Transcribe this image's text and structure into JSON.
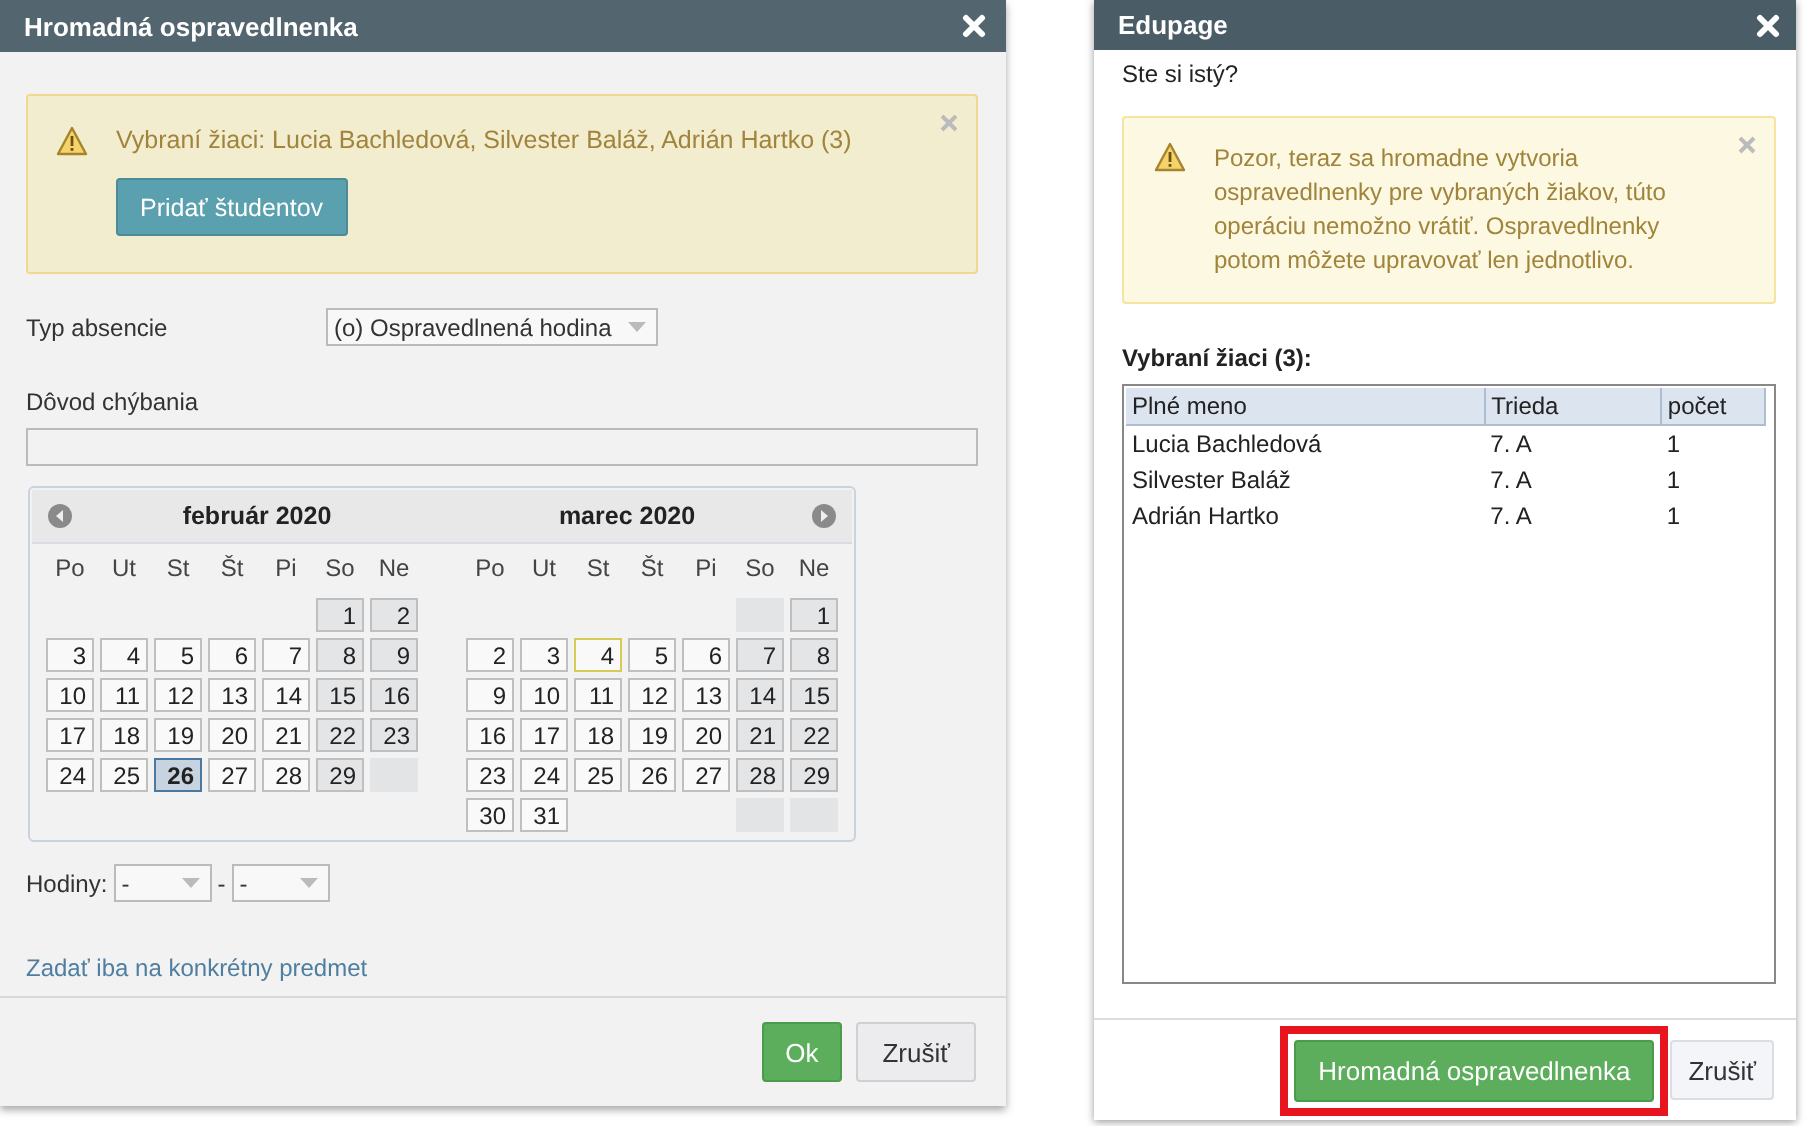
{
  "left_dialog": {
    "title": "Hromadná ospravedlnenka",
    "alert": {
      "text": "Vybraní žiaci: Lucia Bachledová, Silvester Baláž, Adrián Hartko (3)",
      "button": "Pridať študentov"
    },
    "absence_type": {
      "label": "Typ absencie",
      "value": "(o) Ospravedlnená hodina"
    },
    "reason": {
      "label": "Dôvod chýbania"
    },
    "calendar": {
      "months": [
        {
          "title": "február 2020",
          "weekdays": [
            "Po",
            "Ut",
            "St",
            "Št",
            "Pi",
            "So",
            "Ne"
          ],
          "weeks": [
            [
              {
                "day": "1",
                "selected": false,
                "today": false
              },
              {
                "day": "2",
                "selected": false,
                "today": false
              }
            ],
            [
              {
                "day": "3",
                "selected": false,
                "today": false
              },
              {
                "day": "4",
                "selected": false,
                "today": false
              },
              {
                "day": "5",
                "selected": false,
                "today": false
              },
              {
                "day": "6",
                "selected": false,
                "today": false
              },
              {
                "day": "7",
                "selected": false,
                "today": false
              },
              {
                "day": "8",
                "selected": false,
                "today": false
              },
              {
                "day": "9",
                "selected": false,
                "today": false
              }
            ],
            [
              {
                "day": "10",
                "selected": false,
                "today": false
              },
              {
                "day": "11",
                "selected": false,
                "today": false
              },
              {
                "day": "12",
                "selected": false,
                "today": false
              },
              {
                "day": "13",
                "selected": false,
                "today": false
              },
              {
                "day": "14",
                "selected": false,
                "today": false
              },
              {
                "day": "15",
                "selected": false,
                "today": false
              },
              {
                "day": "16",
                "selected": false,
                "today": false
              }
            ],
            [
              {
                "day": "17",
                "selected": false,
                "today": false
              },
              {
                "day": "18",
                "selected": false,
                "today": false
              },
              {
                "day": "19",
                "selected": false,
                "today": false
              },
              {
                "day": "20",
                "selected": false,
                "today": false
              },
              {
                "day": "21",
                "selected": false,
                "today": false
              },
              {
                "day": "22",
                "selected": false,
                "today": false
              },
              {
                "day": "23",
                "selected": false,
                "today": false
              }
            ],
            [
              {
                "day": "24",
                "selected": false,
                "today": false
              },
              {
                "day": "25",
                "selected": false,
                "today": false
              },
              {
                "day": "26",
                "selected": true,
                "today": false
              },
              {
                "day": "27",
                "selected": false,
                "today": false
              },
              {
                "day": "28",
                "selected": false,
                "today": false
              },
              {
                "day": "29",
                "selected": false,
                "today": false
              }
            ]
          ]
        },
        {
          "title": "marec 2020",
          "weekdays": [
            "Po",
            "Ut",
            "St",
            "Št",
            "Pi",
            "So",
            "Ne"
          ],
          "weeks": [
            [
              {
                "day": "1",
                "selected": false,
                "today": false
              }
            ],
            [
              {
                "day": "2",
                "selected": false,
                "today": false
              },
              {
                "day": "3",
                "selected": false,
                "today": false
              },
              {
                "day": "4",
                "selected": false,
                "today": true
              },
              {
                "day": "5",
                "selected": false,
                "today": false
              },
              {
                "day": "6",
                "selected": false,
                "today": false
              },
              {
                "day": "7",
                "selected": false,
                "today": false
              },
              {
                "day": "8",
                "selected": false,
                "today": false
              }
            ],
            [
              {
                "day": "9",
                "selected": false,
                "today": false
              },
              {
                "day": "10",
                "selected": false,
                "today": false
              },
              {
                "day": "11",
                "selected": false,
                "today": false
              },
              {
                "day": "12",
                "selected": false,
                "today": false
              },
              {
                "day": "13",
                "selected": false,
                "today": false
              },
              {
                "day": "14",
                "selected": false,
                "today": false
              },
              {
                "day": "15",
                "selected": false,
                "today": false
              }
            ],
            [
              {
                "day": "16",
                "selected": false,
                "today": false
              },
              {
                "day": "17",
                "selected": false,
                "today": false
              },
              {
                "day": "18",
                "selected": false,
                "today": false
              },
              {
                "day": "19",
                "selected": false,
                "today": false
              },
              {
                "day": "20",
                "selected": false,
                "today": false
              },
              {
                "day": "21",
                "selected": false,
                "today": false
              },
              {
                "day": "22",
                "selected": false,
                "today": false
              }
            ],
            [
              {
                "day": "23",
                "selected": false,
                "today": false
              },
              {
                "day": "24",
                "selected": false,
                "today": false
              },
              {
                "day": "25",
                "selected": false,
                "today": false
              },
              {
                "day": "26",
                "selected": false,
                "today": false
              },
              {
                "day": "27",
                "selected": false,
                "today": false
              },
              {
                "day": "28",
                "selected": false,
                "today": false
              },
              {
                "day": "29",
                "selected": false,
                "today": false
              }
            ],
            [
              {
                "day": "30",
                "selected": false,
                "today": false
              },
              {
                "day": "31",
                "selected": false,
                "today": false
              }
            ]
          ]
        }
      ]
    },
    "hours": {
      "label": "Hodiny:",
      "from": "-",
      "separator": "-",
      "to": "-"
    },
    "link": "Zadať iba na konkrétny predmet",
    "buttons": [
      {
        "label": "Ok",
        "kind": "primary",
        "highlighted": false
      },
      {
        "label": "Zrušiť",
        "kind": "secondary",
        "highlighted": false
      }
    ]
  },
  "right_dialog": {
    "title": "Edupage",
    "question": "Ste si istý?",
    "alert": {
      "text": "Pozor, teraz sa hromadne vytvoria ospravedlnenky pre vybraných žiakov, túto operáciu nemožno vrátiť. Ospravedlnenky potom môžete upravovať len jednotlivo."
    },
    "table_title": "Vybraní žiaci (3):",
    "table": {
      "columns": [
        "Plné meno",
        "Trieda",
        "počet"
      ],
      "rows": [
        [
          "Lucia Bachledová",
          "7. A",
          "1"
        ],
        [
          "Silvester Baláž",
          "7. A",
          "1"
        ],
        [
          "Adrián Hartko",
          "7. A",
          "1"
        ]
      ]
    },
    "buttons": [
      {
        "label": "Hromadná ospravedlnenka",
        "kind": "primary",
        "highlighted": true
      },
      {
        "label": "Zrušiť",
        "kind": "secondary",
        "highlighted": false
      }
    ]
  }
}
